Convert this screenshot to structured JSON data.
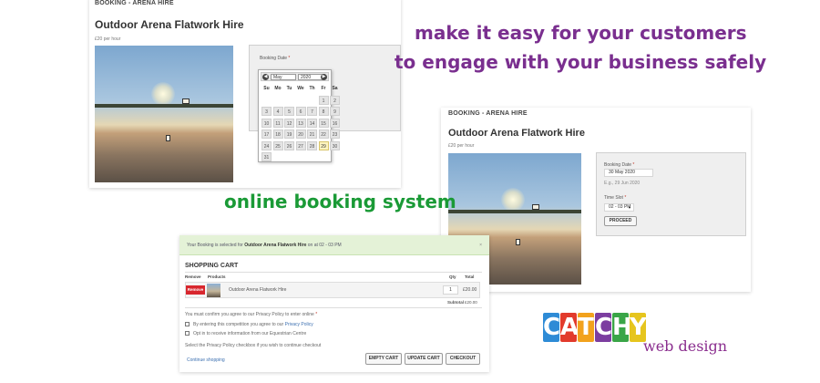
{
  "headline": {
    "line1": "make it easy for your customers",
    "line2": "to engage with your business safely",
    "color": "#7a2f8f"
  },
  "tagline": {
    "text": "online booking system",
    "color": "#1a9a36"
  },
  "shot1": {
    "breadcrumb": "BOOKING - ARENA HIRE",
    "title": "Outdoor Arena Flatwork Hire",
    "price": "£20 per hour",
    "form": {
      "booking_date_label": "Booking Date",
      "required_mark": "*"
    },
    "calendar": {
      "prev_icon": "prev-arrow-icon",
      "next_icon": "next-arrow-icon",
      "prev_glyph": "◀",
      "next_glyph": "▶",
      "month": "May",
      "year": "2020",
      "weekdays": [
        "Su",
        "Mo",
        "Tu",
        "We",
        "Th",
        "Fr",
        "Sa"
      ],
      "days": [
        "",
        "",
        "",
        "",
        "",
        "1",
        "2",
        "3",
        "4",
        "5",
        "6",
        "7",
        "8",
        "9",
        "10",
        "11",
        "12",
        "13",
        "14",
        "15",
        "16",
        "17",
        "18",
        "19",
        "20",
        "21",
        "22",
        "23",
        "24",
        "25",
        "26",
        "27",
        "28",
        "29",
        "30",
        "31"
      ],
      "highlighted_day": "29"
    }
  },
  "shot2": {
    "breadcrumb": "BOOKING - ARENA HIRE",
    "title": "Outdoor Arena Flatwork Hire",
    "price": "£20 per hour",
    "form": {
      "booking_date_label": "Booking Date",
      "required_mark": "*",
      "booking_date_value": "30 May 2020",
      "date_hint": "E.g., 29 Jun 2020",
      "time_slot_label": "Time Slot",
      "time_slot_value": "02 - 03 PM",
      "proceed_label": "PROCEED"
    }
  },
  "cart": {
    "notice_prefix": "Your Booking is selected for",
    "notice_item": "Outdoor Arena Flatwork Hire",
    "notice_suffix": "on at 02 - 03 PM",
    "close_glyph": "×",
    "title": "SHOPPING CART",
    "columns": {
      "remove": "Remove",
      "products": "Products",
      "qty": "Qty",
      "total": "Total"
    },
    "item": {
      "remove_label": "Remove",
      "name": "Outdoor Arena Flatwork Hire",
      "qty": "1",
      "total": "£20.00"
    },
    "subtotal_label": "Subtotal",
    "subtotal_value": "£20.00",
    "privacy_confirm": "You must confirm you agree to our Privacy Policy to enter online",
    "required_mark": "*",
    "checkbox1_text": "By entering this competition you agree to our",
    "checkbox1_link": "Privacy Policy",
    "checkbox2_text": "Opt in to receive information from our Equestrian Centre",
    "instruction": "Select the Privacy Policy checkbox if you wish to continue checkout",
    "continue_link": "Continue shopping",
    "buttons": {
      "empty": "EMPTY CART",
      "update": "UPDATE CART",
      "checkout": "CHECKOUT"
    }
  },
  "logo": {
    "letters": [
      "C",
      "A",
      "T",
      "C",
      "H",
      "Y"
    ],
    "letter_colors": [
      "#2e8bd6",
      "#e23b2c",
      "#f2a21d",
      "#7c3ea0",
      "#3aa547",
      "#e6c51e"
    ],
    "subtitle": "web design"
  }
}
